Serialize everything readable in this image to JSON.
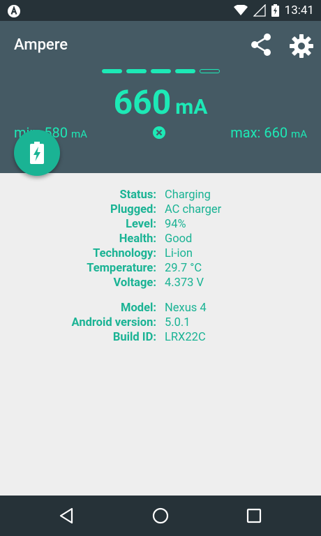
{
  "statusbar": {
    "time": "13:41"
  },
  "header": {
    "title": "Ampere",
    "current": {
      "value": "660",
      "unit": "mA"
    },
    "min": {
      "label": "min: 580",
      "unit": "mA"
    },
    "max": {
      "label": "max: 660",
      "unit": "mA"
    },
    "level_bars": {
      "filled": 4,
      "total": 5
    }
  },
  "battery_info": [
    {
      "label": "Status:",
      "value": "Charging"
    },
    {
      "label": "Plugged:",
      "value": "AC charger"
    },
    {
      "label": "Level:",
      "value": "94%"
    },
    {
      "label": "Health:",
      "value": "Good"
    },
    {
      "label": "Technology:",
      "value": "Li-ion"
    },
    {
      "label": "Temperature:",
      "value": "29.7 °C"
    },
    {
      "label": "Voltage:",
      "value": "4.373 V"
    }
  ],
  "device_info": [
    {
      "label": "Model:",
      "value": "Nexus 4"
    },
    {
      "label": "Android version:",
      "value": "5.0.1"
    },
    {
      "label": "Build ID:",
      "value": "LRX22C"
    }
  ],
  "icons": {
    "share": "share-icon",
    "settings": "gear-icon",
    "reset": "close-circle-icon",
    "fab": "battery-charging-icon",
    "wifi": "wifi-icon",
    "signal": "signal-icon",
    "battery": "battery-charging-icon"
  },
  "colors": {
    "accent": "#1de9b6",
    "text_accent": "#1ab394",
    "header_bg": "#455a64",
    "statusbar_bg": "#263238",
    "page_bg": "#eeeeee"
  }
}
